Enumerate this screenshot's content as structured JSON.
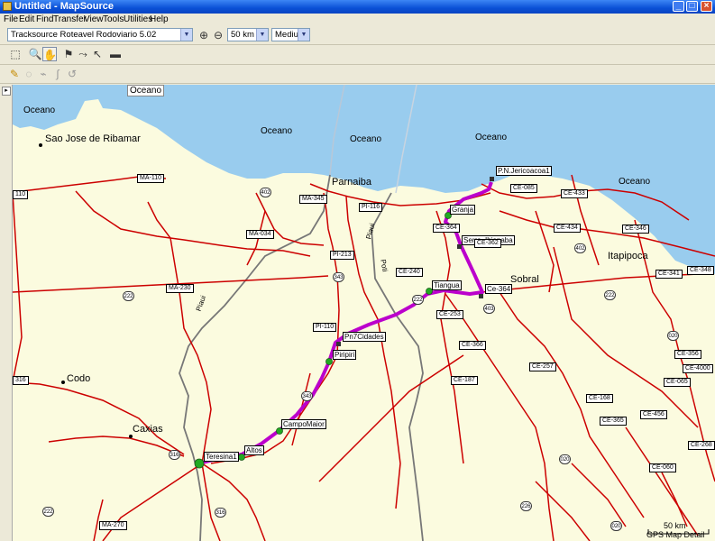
{
  "window": {
    "title": "Untitled - MapSource"
  },
  "menu": [
    "File",
    "Edit",
    "Find",
    "Transfer",
    "View",
    "Tools",
    "Utilities",
    "Help"
  ],
  "toolbar": {
    "map_product": "Tracksource Roteavel Rodoviario 5.02",
    "zoom": "50 km",
    "detail": "Medium"
  },
  "map": {
    "ocean_labels": [
      "Oceano",
      "Oceano",
      "Oceano",
      "Oceano",
      "Oceano",
      "Oceano"
    ],
    "cities": {
      "sao_jose": "Sao Jose de Ribamar",
      "parnaiba": "Parnaiba",
      "sobral": "Sobral",
      "itapipoca": "Itapipoca",
      "codo": "Codo",
      "caxias": "Caxias"
    },
    "river_labels": [
      "Piaui",
      "Piaui",
      "Poti"
    ],
    "waypoints": {
      "jericoacoara": "P.N.Jericoacoa1",
      "granja": "Granja",
      "serra": "Serra_Ibiapaba",
      "tiangua": "Tiangua",
      "ce364": "Ce-364",
      "sete_cidades": "Pn7Cidades",
      "piripiri": "Piripiri",
      "campo_maior": "CampoMaior",
      "altos": "Altos",
      "teresina": "Teresina1"
    },
    "road_shields": {
      "ma110": "MA-110",
      "ma345": "MA-345",
      "ma034": "MA-034",
      "ma230": "MA-230",
      "ma270": "MA-270",
      "pi116": "PI-116",
      "pi213": "PI-213",
      "pi110": "PI-110",
      "ce085": "CE-085",
      "ce433": "CE-433",
      "ce434": "CE-434",
      "ce346": "CE-346",
      "ce341": "CE-341",
      "ce348": "CE-348",
      "ce364": "CE-364",
      "ce362": "CE-362",
      "ce240": "CE-240",
      "ce253": "CE-253",
      "ce366": "CE-366",
      "ce257": "CE-257",
      "ce187": "CE-187",
      "ce168": "CE-168",
      "ce365": "CE-365",
      "ce456": "CE-456",
      "ce060": "CE-060",
      "ce356": "CE-356",
      "ce4000": "CE-4000",
      "ce065": "CE-065",
      "ce268": "CE-268",
      "sh110": "110",
      "sh316": "316"
    },
    "route_markers": [
      "402",
      "343",
      "222",
      "222",
      "403",
      "402",
      "222",
      "020",
      "343",
      "316",
      "316",
      "226",
      "020",
      "020",
      "222"
    ],
    "scale": {
      "label": "50 km"
    },
    "footer": "GPS Map Detail"
  }
}
